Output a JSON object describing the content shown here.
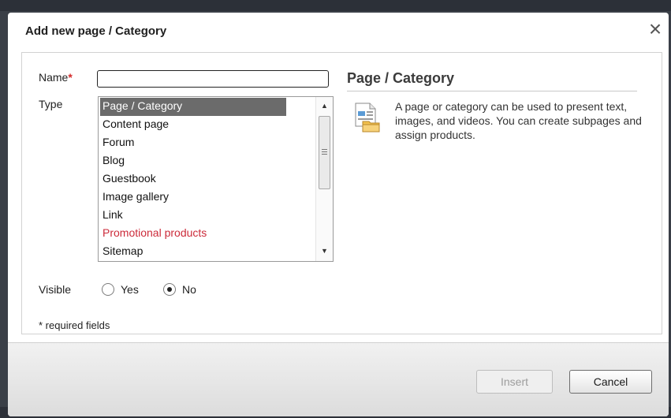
{
  "dialog": {
    "title": "Add new page / Category",
    "close_icon": "close-icon"
  },
  "form": {
    "name_label": "Name",
    "required_mark": "*",
    "name_value": "",
    "type_label": "Type",
    "type_options": [
      "Page / Category",
      "Content page",
      "Forum",
      "Blog",
      "Guestbook",
      "Image gallery",
      "Link",
      "Promotional products",
      "Sitemap"
    ],
    "type_selected": "Page / Category",
    "visible_label": "Visible",
    "visible_options": [
      {
        "label": "Yes",
        "checked": false
      },
      {
        "label": "No",
        "checked": true
      }
    ],
    "required_note": "* required fields"
  },
  "info": {
    "title": "Page / Category",
    "icon": "page-folder-icon",
    "description": "A page or category can be used to present text, images, and videos. You can create subpages and assign products."
  },
  "footer": {
    "insert_label": "Insert",
    "cancel_label": "Cancel"
  },
  "colors": {
    "selected_bg": "#6b6b6b",
    "promo_text": "#cc2b3a",
    "required_mark": "#d42b2b"
  }
}
